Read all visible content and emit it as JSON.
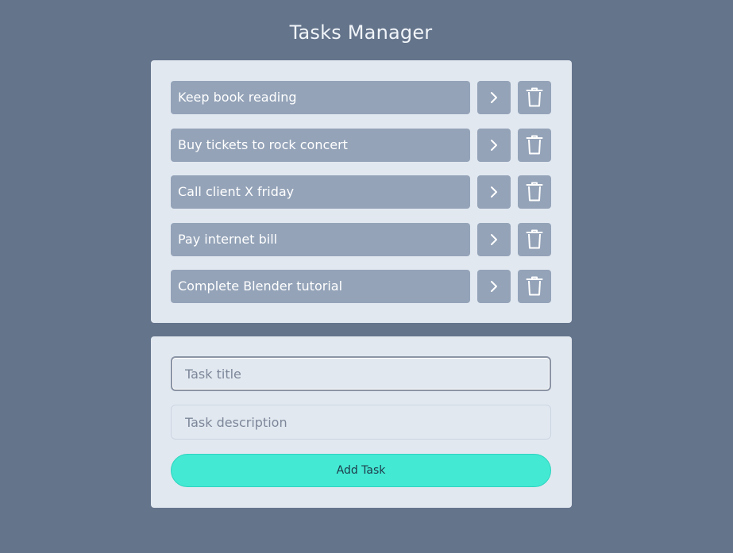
{
  "app": {
    "title": "Tasks Manager"
  },
  "tasks": [
    {
      "title": "Keep book reading"
    },
    {
      "title": "Buy tickets to rock concert"
    },
    {
      "title": "Call client X friday"
    },
    {
      "title": "Pay internet bill"
    },
    {
      "title": "Complete Blender tutorial"
    }
  ],
  "form": {
    "title_placeholder": "Task title",
    "title_value": "",
    "description_placeholder": "Task description",
    "description_value": "",
    "add_button_label": "Add Task"
  },
  "icons": {
    "open": "chevron-right-icon",
    "delete": "trash-icon"
  },
  "colors": {
    "background": "#64748b",
    "card": "#e2e8f0",
    "task_item": "#94a3b8",
    "accent": "#43e9d3"
  }
}
